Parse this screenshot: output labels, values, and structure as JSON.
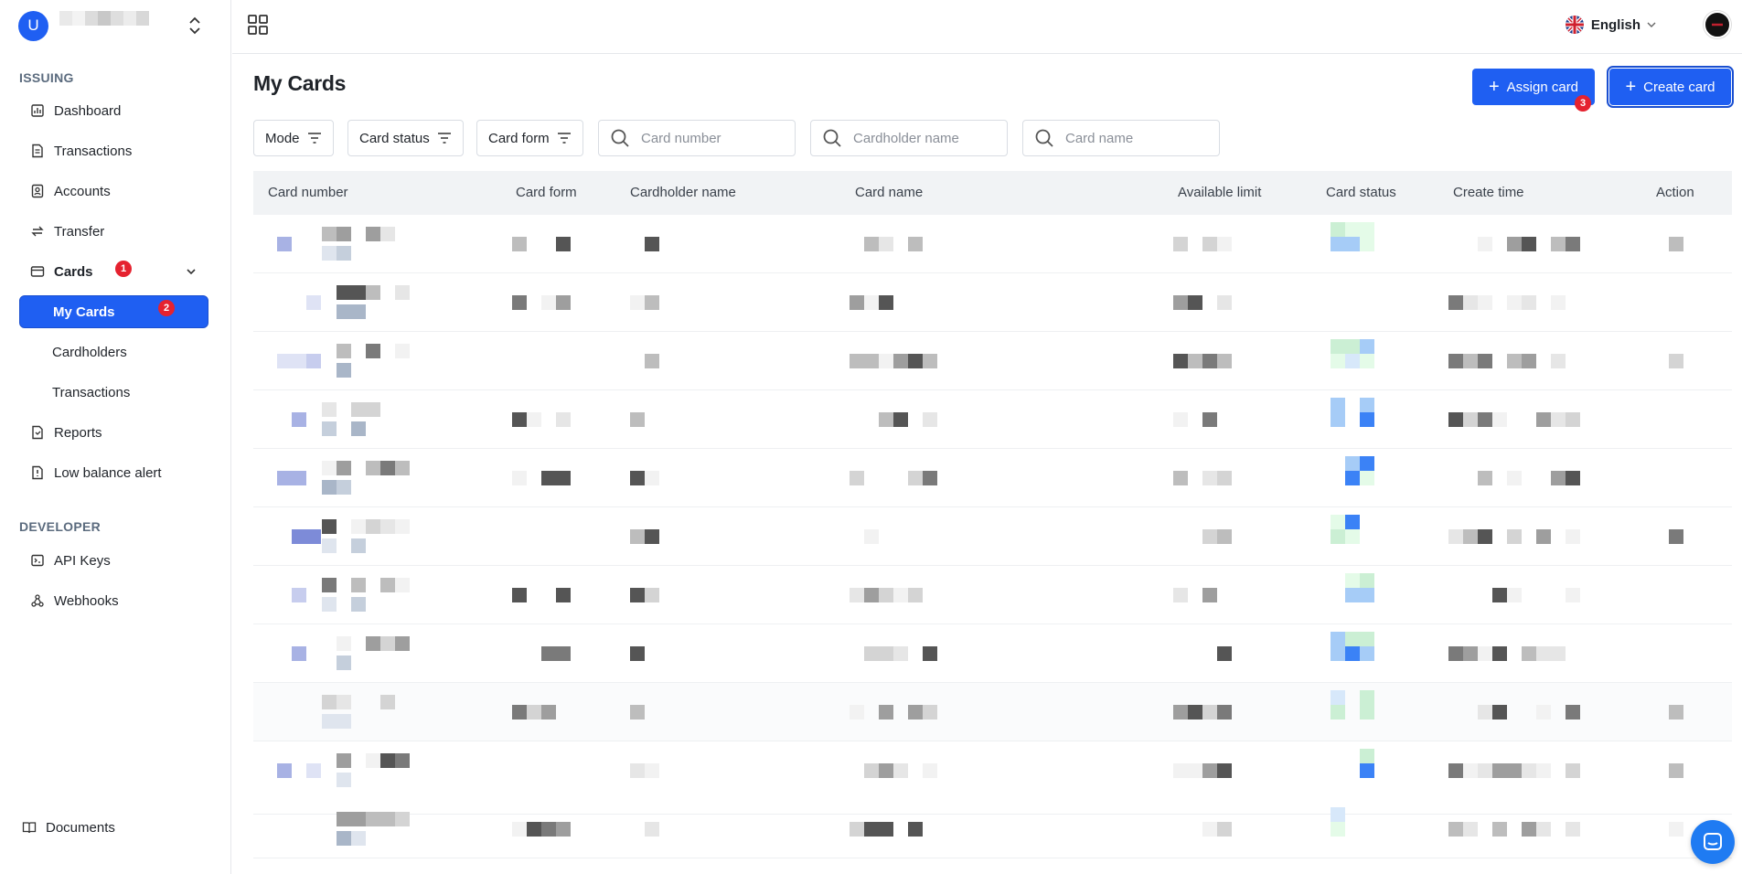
{
  "org": {
    "avatar_letter": "U"
  },
  "sidebar": {
    "issuing_label": "ISSUING",
    "developer_label": "DEVELOPER",
    "items": {
      "dashboard": "Dashboard",
      "transactions": "Transactions",
      "accounts": "Accounts",
      "transfer": "Transfer",
      "cards": "Cards",
      "my_cards": "My Cards",
      "cardholders": "Cardholders",
      "card_transactions": "Transactions",
      "reports": "Reports",
      "low_balance_alert": "Low balance alert",
      "api_keys": "API Keys",
      "webhooks": "Webhooks",
      "documents": "Documents"
    },
    "badges": {
      "cards": "1",
      "my_cards": "2"
    }
  },
  "topbar": {
    "language": "English"
  },
  "main": {
    "title": "My Cards",
    "assign_button": "Assign card",
    "assign_badge": "3",
    "create_button": "Create card",
    "filters": {
      "mode": "Mode",
      "card_status": "Card status",
      "card_form": "Card form"
    },
    "search": {
      "card_number_placeholder": "Card number",
      "cardholder_placeholder": "Cardholder name",
      "card_name_placeholder": "Card name"
    },
    "table": {
      "columns": [
        "Card number",
        "Card form",
        "Cardholder name",
        "Card name",
        "Available limit",
        "Card status",
        "Create time",
        "Action"
      ]
    }
  },
  "colors": {
    "accent": "#1f5ff2",
    "badge": "#e5222f"
  },
  "icons": [
    "apps-grid-icon",
    "uk-flag-icon",
    "chevron-down-icon",
    "filter-icon",
    "search-icon",
    "chat-icon"
  ]
}
